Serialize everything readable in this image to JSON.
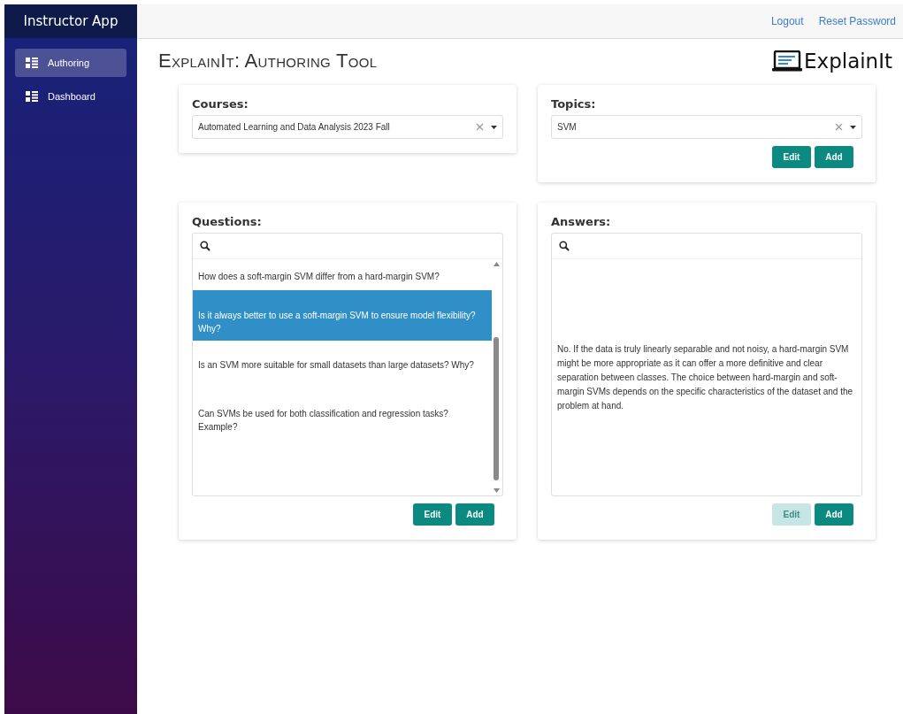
{
  "sidebar": {
    "title": "Instructor App",
    "items": [
      {
        "label": "Authoring",
        "selected": true
      },
      {
        "label": "Dashboard",
        "selected": false
      }
    ]
  },
  "top_bar": {
    "links": [
      "Logout",
      "Reset Password"
    ]
  },
  "page": {
    "title": "ExplainIt: Authoring Tool",
    "logo_text": "ExplainIt"
  },
  "courses": {
    "label": "Courses:",
    "value": "Automated Learning and Data Analysis 2023 Fall"
  },
  "topics": {
    "label": "Topics:",
    "value": "SVM",
    "buttons": [
      {
        "label": "Edit",
        "disabled": false
      },
      {
        "label": "Add",
        "disabled": false
      }
    ]
  },
  "questions": {
    "label": "Questions:",
    "items": [
      {
        "text": "How does a soft-margin SVM differ from a hard-margin SVM?",
        "selected": false
      },
      {
        "text": "Is it always better to use a soft-margin SVM to ensure model flexibility? Why?",
        "selected": true
      },
      {
        "text": "Is an SVM more suitable for small datasets than large datasets? Why?",
        "selected": false
      },
      {
        "text": "Can SVMs be used for both classification and regression tasks? Example?",
        "selected": false
      }
    ],
    "buttons": [
      {
        "label": "Edit",
        "disabled": false
      },
      {
        "label": "Add",
        "disabled": false
      }
    ]
  },
  "answers": {
    "label": "Answers:",
    "text": "No. If the data is truly linearly separable and not noisy, a hard-margin SVM might be more appropriate as it can offer a more definitive and clear separation between classes. The choice between hard-margin and soft-margin SVMs depends on the specific characteristics of the dataset and the problem at hand.",
    "buttons": [
      {
        "label": "Edit",
        "disabled": true
      },
      {
        "label": "Add",
        "disabled": false
      }
    ]
  }
}
